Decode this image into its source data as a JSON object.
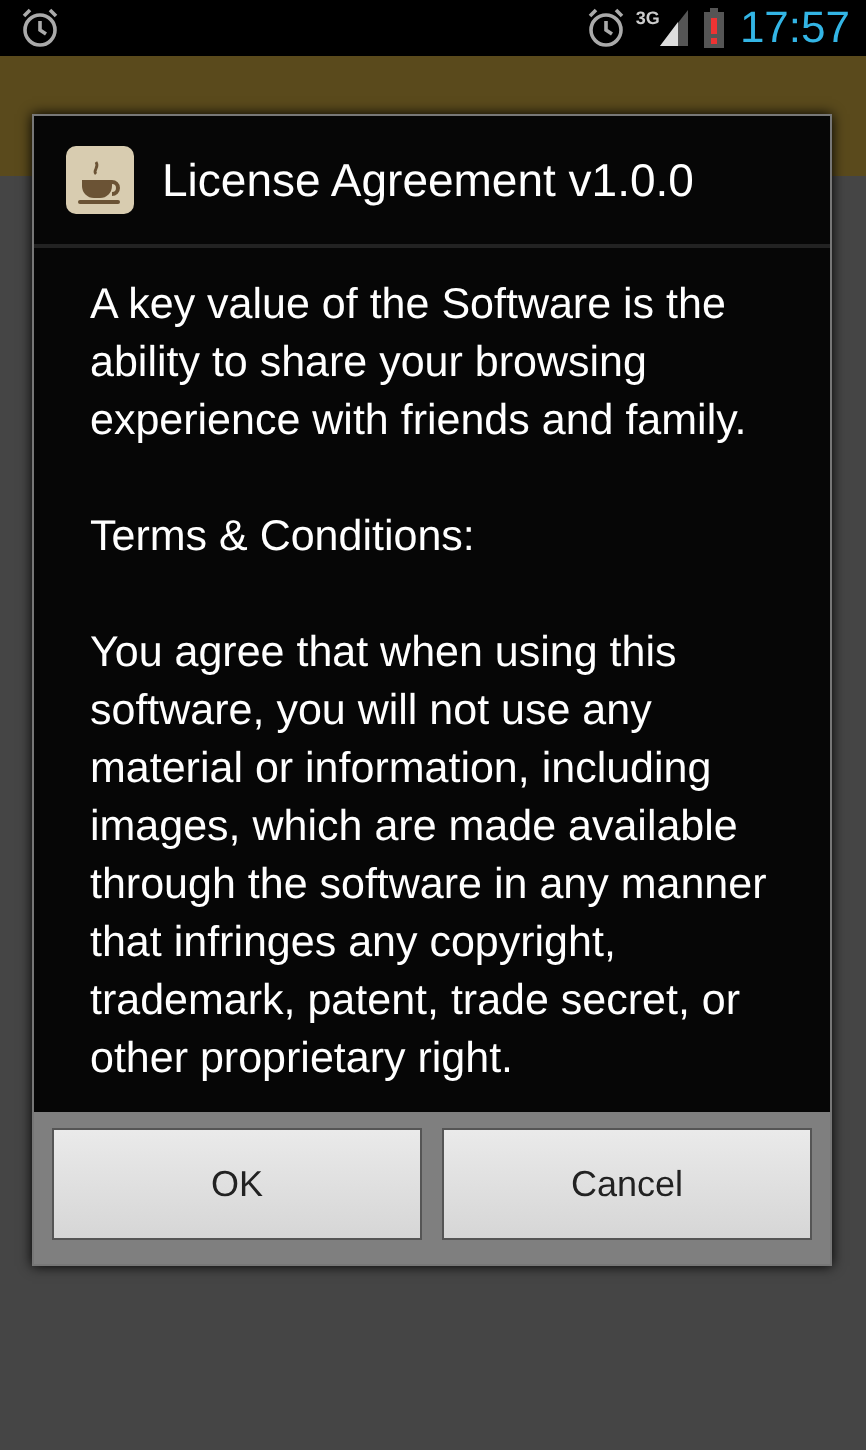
{
  "status_bar": {
    "network": "3G",
    "time": "17:57"
  },
  "dialog": {
    "title": "License Agreement v1.0.0",
    "paragraphs": [
      "A key value of the Software is the ability to share your browsing experience with friends and family.",
      "Terms & Conditions:",
      "You agree that when using this software, you will not use any material or information, including images, which are made available through the software in any manner that infringes any copyright, trademark, patent, trade secret, or other proprietary right."
    ],
    "buttons": [
      "OK",
      "Cancel"
    ]
  }
}
